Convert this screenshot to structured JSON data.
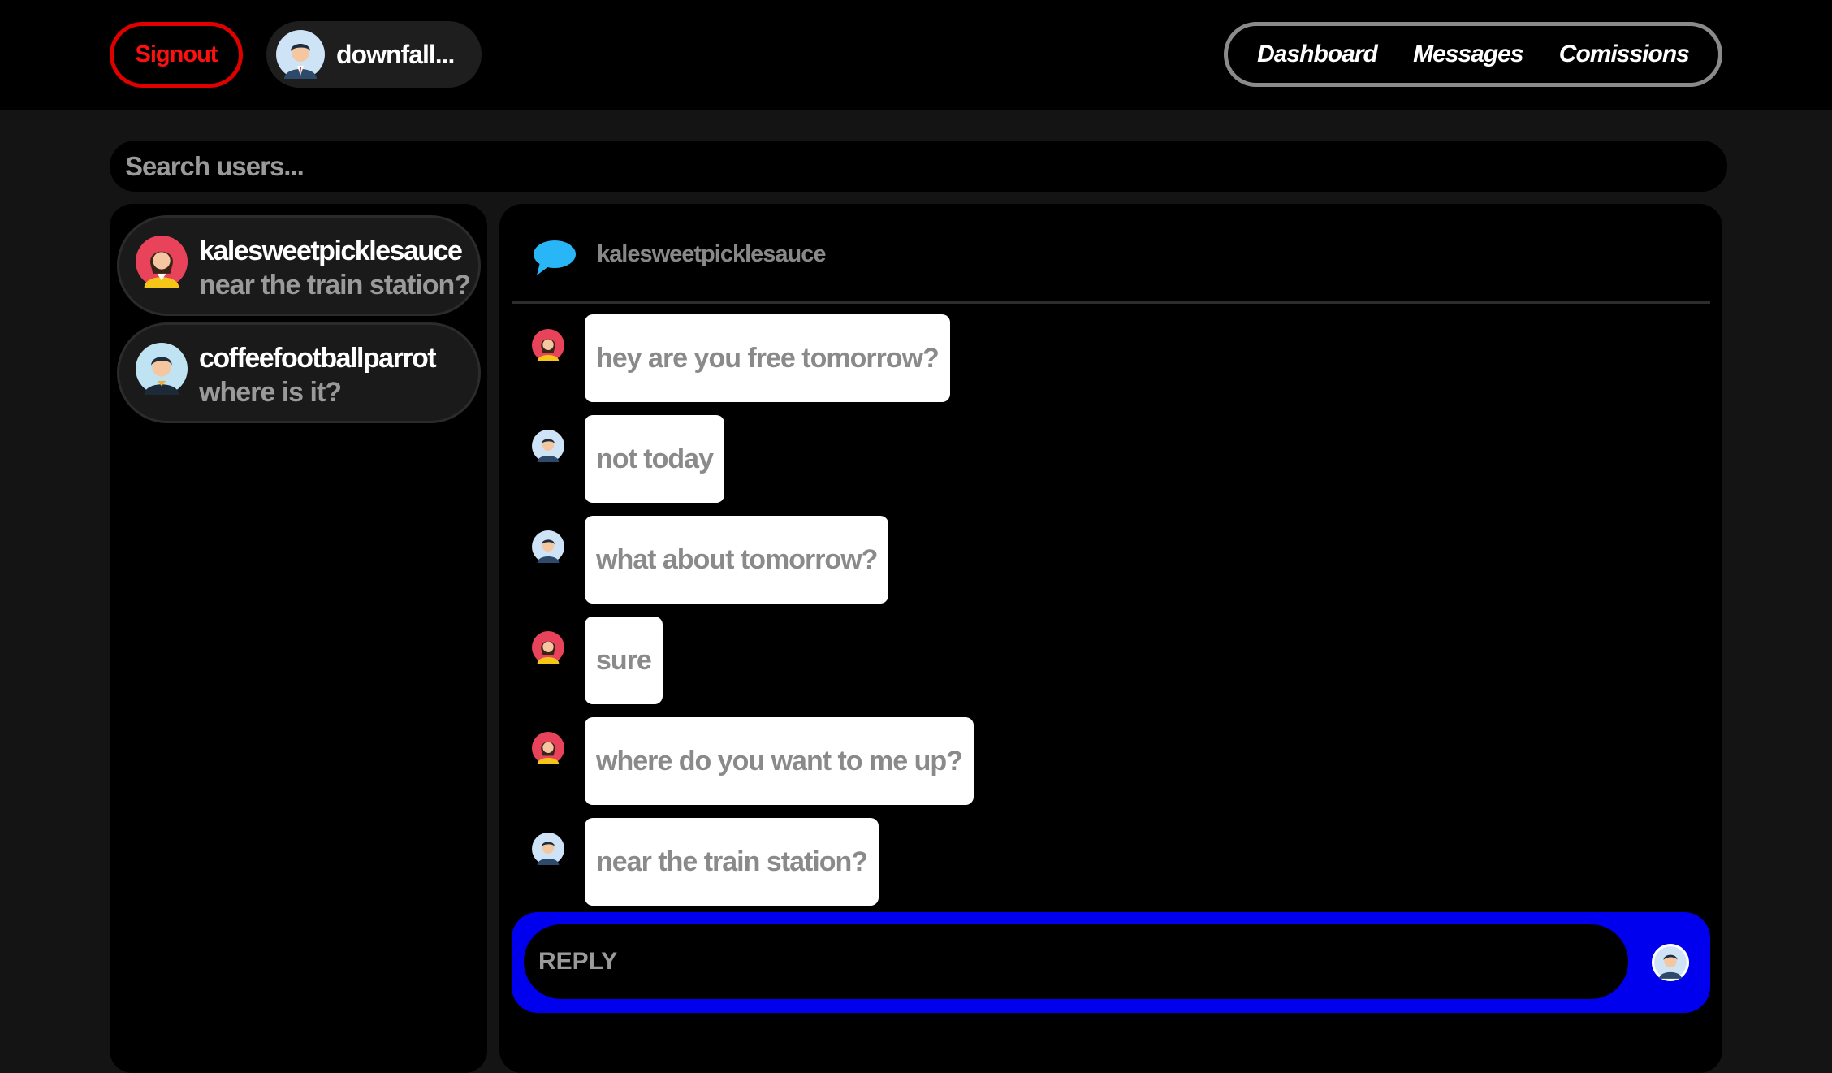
{
  "header": {
    "signout_label": "Signout",
    "current_user": "downfall...",
    "nav": [
      "Dashboard",
      "Messages",
      "Comissions"
    ]
  },
  "search": {
    "placeholder": "Search users..."
  },
  "sidebar": {
    "conversations": [
      {
        "name": "kalesweetpicklesauce",
        "preview": "near the train station?",
        "avatar": "female-avatar-icon"
      },
      {
        "name": "coffeefootballparrot",
        "preview": "where is it?",
        "avatar": "male-avatar-icon"
      }
    ]
  },
  "chat": {
    "partner": "kalesweetpicklesauce",
    "header_icon": "speech-bubble-icon",
    "messages": [
      {
        "text": "hey are you free tomorrow?",
        "sender": "partner"
      },
      {
        "text": "not today",
        "sender": "me"
      },
      {
        "text": "what about tomorrow?",
        "sender": "me"
      },
      {
        "text": "sure",
        "sender": "partner"
      },
      {
        "text": "where do you want to me up?",
        "sender": "partner"
      },
      {
        "text": "near the train station?",
        "sender": "me"
      }
    ],
    "reply_placeholder": "REPLY"
  },
  "colors": {
    "accent_red": "#e00000",
    "reply_bar_blue": "#0000ee",
    "chat_icon_blue": "#29b6f6"
  }
}
